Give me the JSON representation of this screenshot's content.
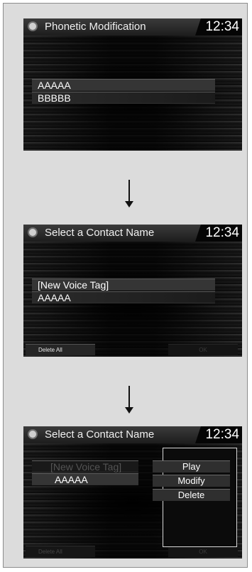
{
  "screens": [
    {
      "title": "Phonetic Modification",
      "clock": "12:34",
      "items": [
        "AAAAA",
        "BBBBB"
      ]
    },
    {
      "title": "Select a Contact Name",
      "clock": "12:34",
      "items": [
        "[New Voice Tag]",
        "AAAAA"
      ],
      "delete_all_label": "Delete All",
      "ok_label": "OK"
    },
    {
      "title": "Select a Contact Name",
      "clock": "12:34",
      "items": [
        "[New Voice Tag]",
        "AAAAA"
      ],
      "delete_all_label": "Delete All",
      "ok_label": "OK",
      "popup": [
        "Play",
        "Modify",
        "Delete"
      ]
    }
  ],
  "icons": {
    "title_icon": "gear-icon",
    "arrow": "arrow-down-icon"
  },
  "colors": {
    "screen_bg": "#070707",
    "frame_bg": "#dcdcdc"
  }
}
